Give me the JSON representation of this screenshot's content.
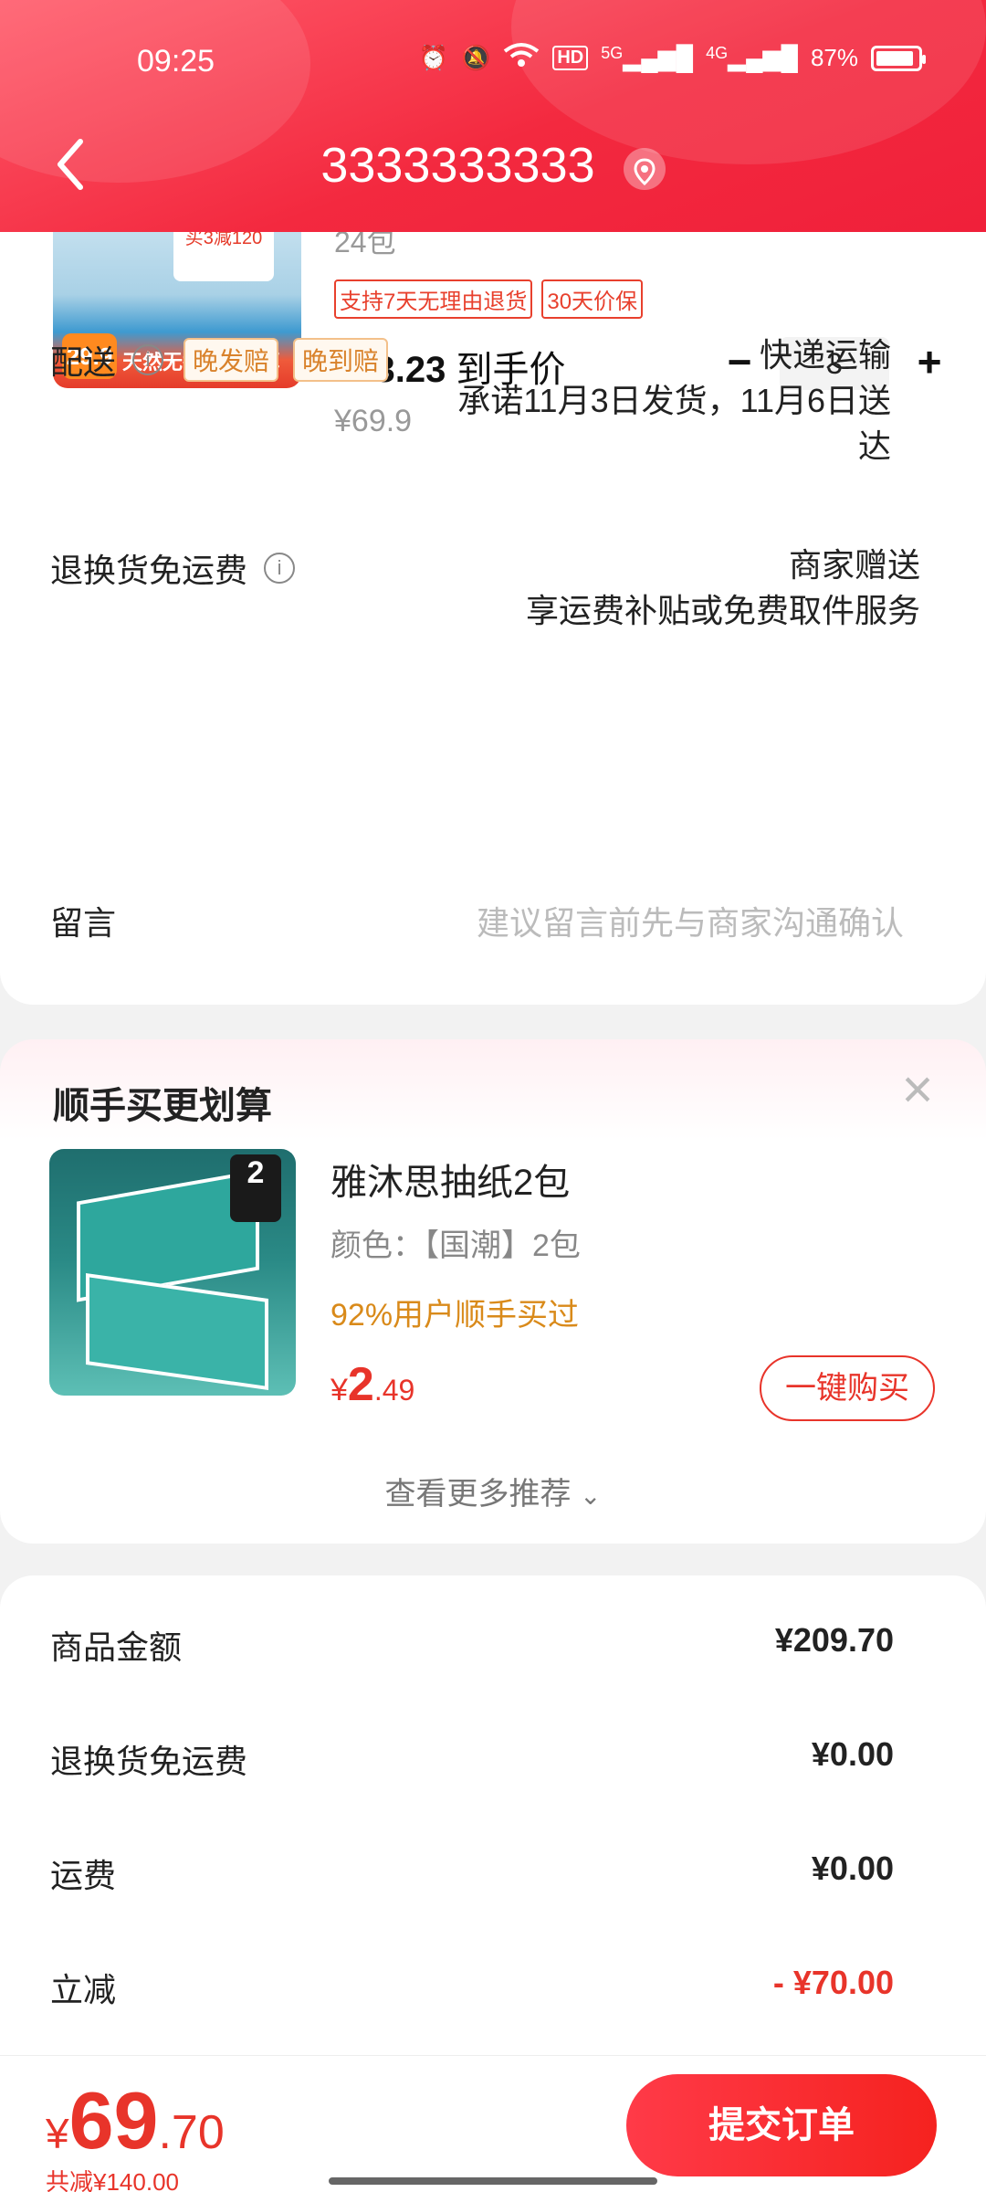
{
  "status_bar": {
    "time": "09:25",
    "battery": "87%",
    "network_5g": "5G",
    "network_4g": "4G",
    "hd": "HD"
  },
  "header": {
    "title": "3333333333"
  },
  "product": {
    "subtitle": "24包",
    "tags": [
      "支持7天无理由退货",
      "30天价保"
    ],
    "price": "¥23.23",
    "price_suffix": "到手价",
    "original_price": "¥69.9",
    "quantity": "3",
    "image_text": {
      "badge": "29.9",
      "strip": "天然无香 4层加厚",
      "promo": "买3减120"
    }
  },
  "delivery": {
    "label": "配送",
    "tags": [
      "晚发赔",
      "晚到赔"
    ],
    "method": "快递运输",
    "promise_line1": "承诺11月3日发货，11月6日送",
    "promise_line2": "达"
  },
  "return_shipping": {
    "label": "退换货免运费",
    "value_line1": "商家赠送",
    "value_line2": "享运费补贴或免费取件服务"
  },
  "message": {
    "label": "留言",
    "placeholder": "建议留言前先与商家沟通确认"
  },
  "recommend": {
    "title": "顺手买更划算",
    "item": {
      "name": "雅沐思抽纸2包",
      "color": "颜色：【国潮】2包",
      "percent_bought": "92%用户顺手买过",
      "price_symbol": "¥",
      "price_int": "2",
      "price_dec": ".49",
      "pack_label": "2"
    },
    "buy_label": "一键购买",
    "more_label": "查看更多推荐"
  },
  "summary": {
    "rows": [
      {
        "label": "商品金额",
        "value": "¥209.70"
      },
      {
        "label": "退换货免运费",
        "value": "¥0.00"
      },
      {
        "label": "运费",
        "value": "¥0.00"
      },
      {
        "label": "立减",
        "value": "- ¥70.00"
      }
    ]
  },
  "bottom_bar": {
    "total_symbol": "¥",
    "total_int": "69",
    "total_dec": ".70",
    "saved": "共减¥140.00",
    "submit_label": "提交订单"
  },
  "colors": {
    "brand_red": "#f3293f",
    "price_red": "#e8342a",
    "orange": "#d9822b"
  }
}
